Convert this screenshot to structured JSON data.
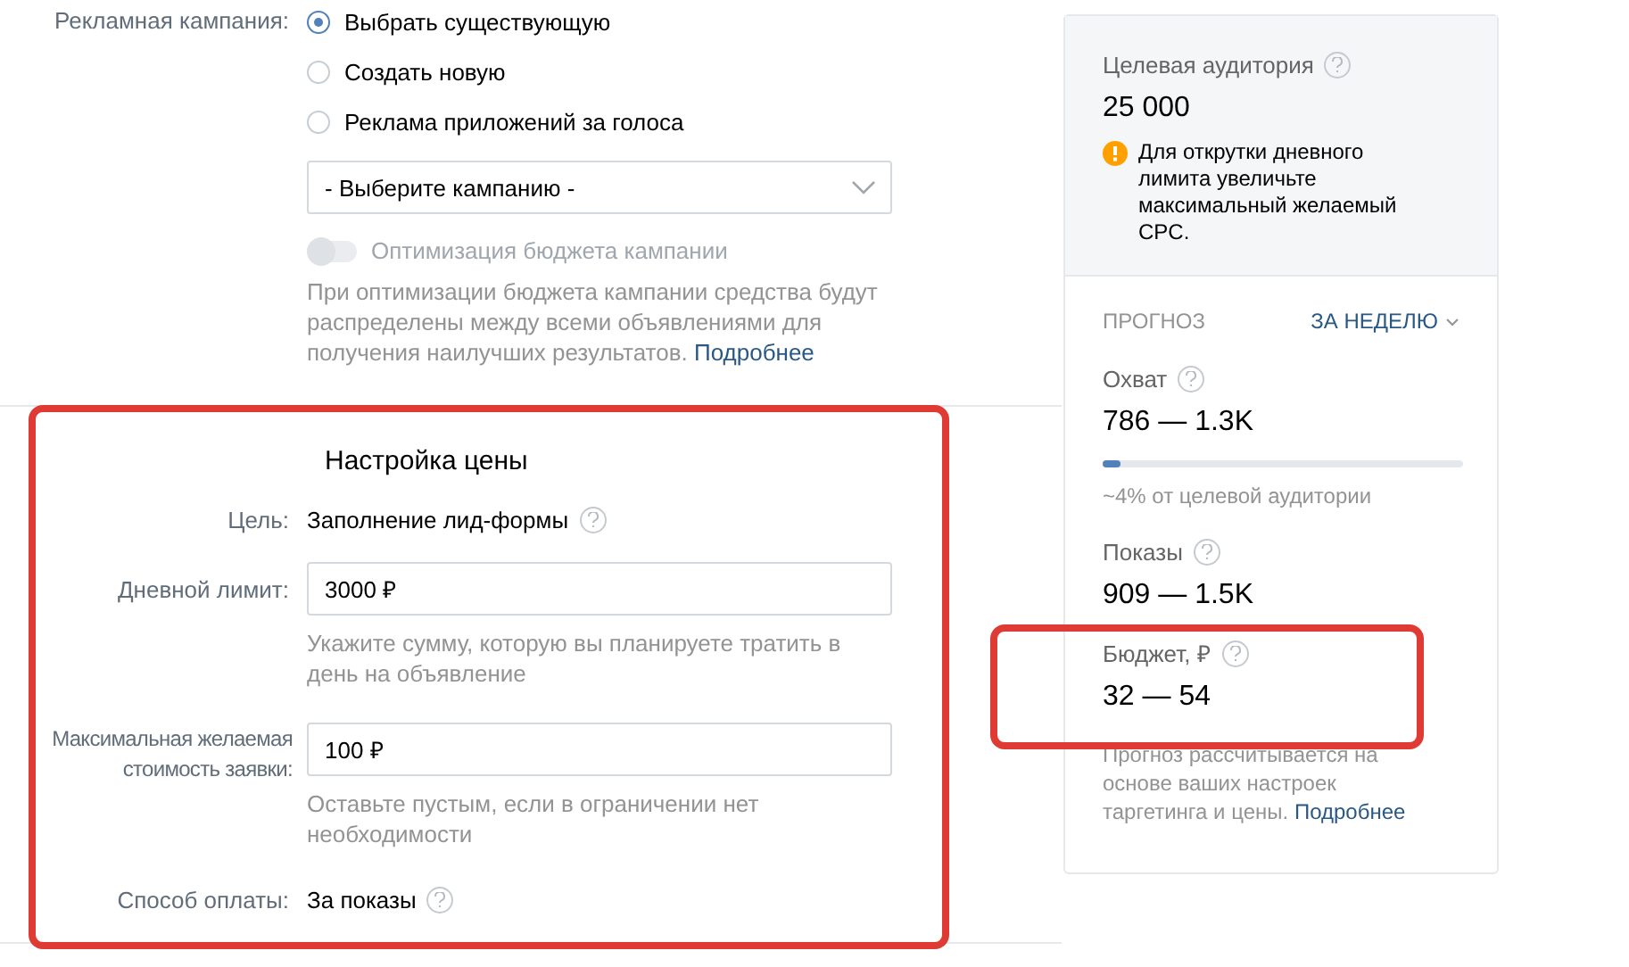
{
  "campaign": {
    "label": "Рекламная кампания:",
    "options": [
      {
        "label": "Выбрать существующую",
        "selected": true
      },
      {
        "label": "Создать новую",
        "selected": false
      },
      {
        "label": "Реклама приложений за голоса",
        "selected": false
      }
    ],
    "select": {
      "placeholder": "- Выберите кампанию -"
    },
    "optimization": {
      "label": "Оптимизация бюджета кампании",
      "on": false,
      "disabled": true
    },
    "description": "При оптимизации бюджета кампании средства будут распределены между всеми объявлениями для получения наилучших результатов.",
    "more_link": "Подробнее"
  },
  "price": {
    "title": "Настройка цены",
    "goal_label": "Цель:",
    "goal_value": "Заполнение лид-формы",
    "fields": [
      {
        "label": "Дневной лимит:",
        "value": "3000 ₽",
        "hint": "Укажите сумму, которую вы планируете тратить в день на объявление"
      },
      {
        "label": "Максимальная желаемая стоимость заявки:",
        "value": "100 ₽",
        "hint": "Оставьте пустым, если в ограничении нет необходимости"
      }
    ],
    "payment_label": "Способ оплаты:",
    "payment_value": "За показы"
  },
  "sidebar": {
    "audience_label": "Целевая аудитория",
    "audience_value": "25 000",
    "warning": "Для открутки дневного лимита увеличьте максимальный желаемый CPC.",
    "forecast_label": "ПРОГНОЗ",
    "period": "ЗА НЕДЕЛЮ",
    "metrics": [
      {
        "kind": "progress",
        "label": "Охват",
        "value": "786 — 1.3K",
        "level": 0.05,
        "note": "~4% от целевой аудитории"
      },
      {
        "kind": "plain",
        "label": "Показы",
        "value": "909 — 1.5K"
      },
      {
        "kind": "plain",
        "label": "Бюджет, ₽",
        "value": "32 — 54"
      }
    ],
    "footnote": "Прогноз рассчитывается на основе ваших настроек таргетинга и цены.",
    "more_link": "Подробнее"
  }
}
